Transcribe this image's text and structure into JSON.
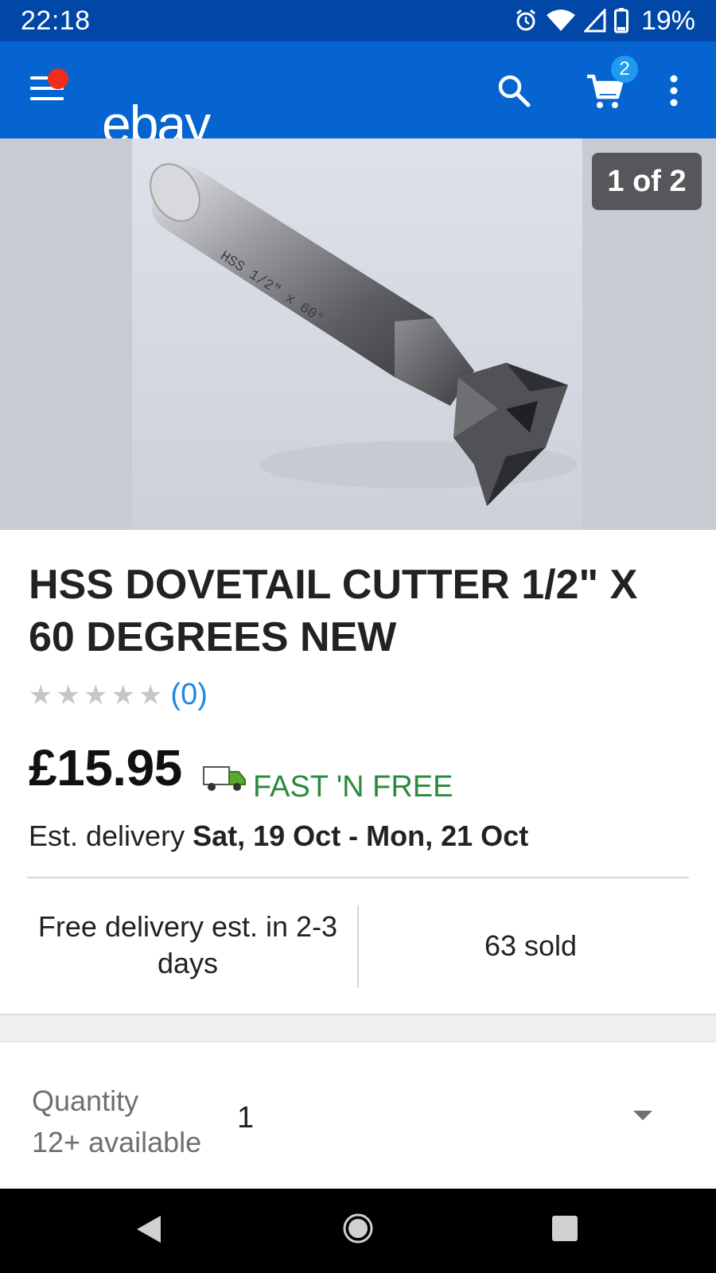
{
  "status_bar": {
    "time": "22:18",
    "battery_percent": "19%",
    "icons": [
      "alarm-icon",
      "wifi-icon",
      "signal-icon",
      "battery-icon"
    ]
  },
  "app_bar": {
    "logo": "ebay",
    "icons": [
      "menu-icon",
      "search-icon",
      "cart-icon",
      "more-icon"
    ],
    "cart_count": "2",
    "colors": {
      "bar": "#0564d0",
      "status": "#0147a8",
      "notification_dot": "#f02d1c",
      "badge": "#1e9bf0"
    }
  },
  "gallery": {
    "counter": "1 of 2",
    "image_text": "HSS 1/2\" x 60°"
  },
  "product": {
    "title": "HSS DOVETAIL CUTTER 1/2\" X 60 DEGREES NEW",
    "rating_count": "(0)",
    "rating_value": 0,
    "rating_max": 5,
    "price": "£15.95",
    "shipping_badge": "FAST 'N FREE",
    "delivery_prefix": "Est. delivery",
    "delivery_dates": "Sat, 19 Oct - Mon, 21 Oct",
    "colors": {
      "fast_free": "#2a8a3e",
      "rating_link": "#1e88e5"
    }
  },
  "info": {
    "free_delivery": "Free delivery est. in 2-3 days",
    "sold": "63 sold"
  },
  "quantity": {
    "label": "Quantity",
    "availability": "12+ available",
    "selected": "1"
  },
  "nav_bar": {
    "icons": [
      "back-icon",
      "home-icon",
      "recents-icon"
    ]
  }
}
